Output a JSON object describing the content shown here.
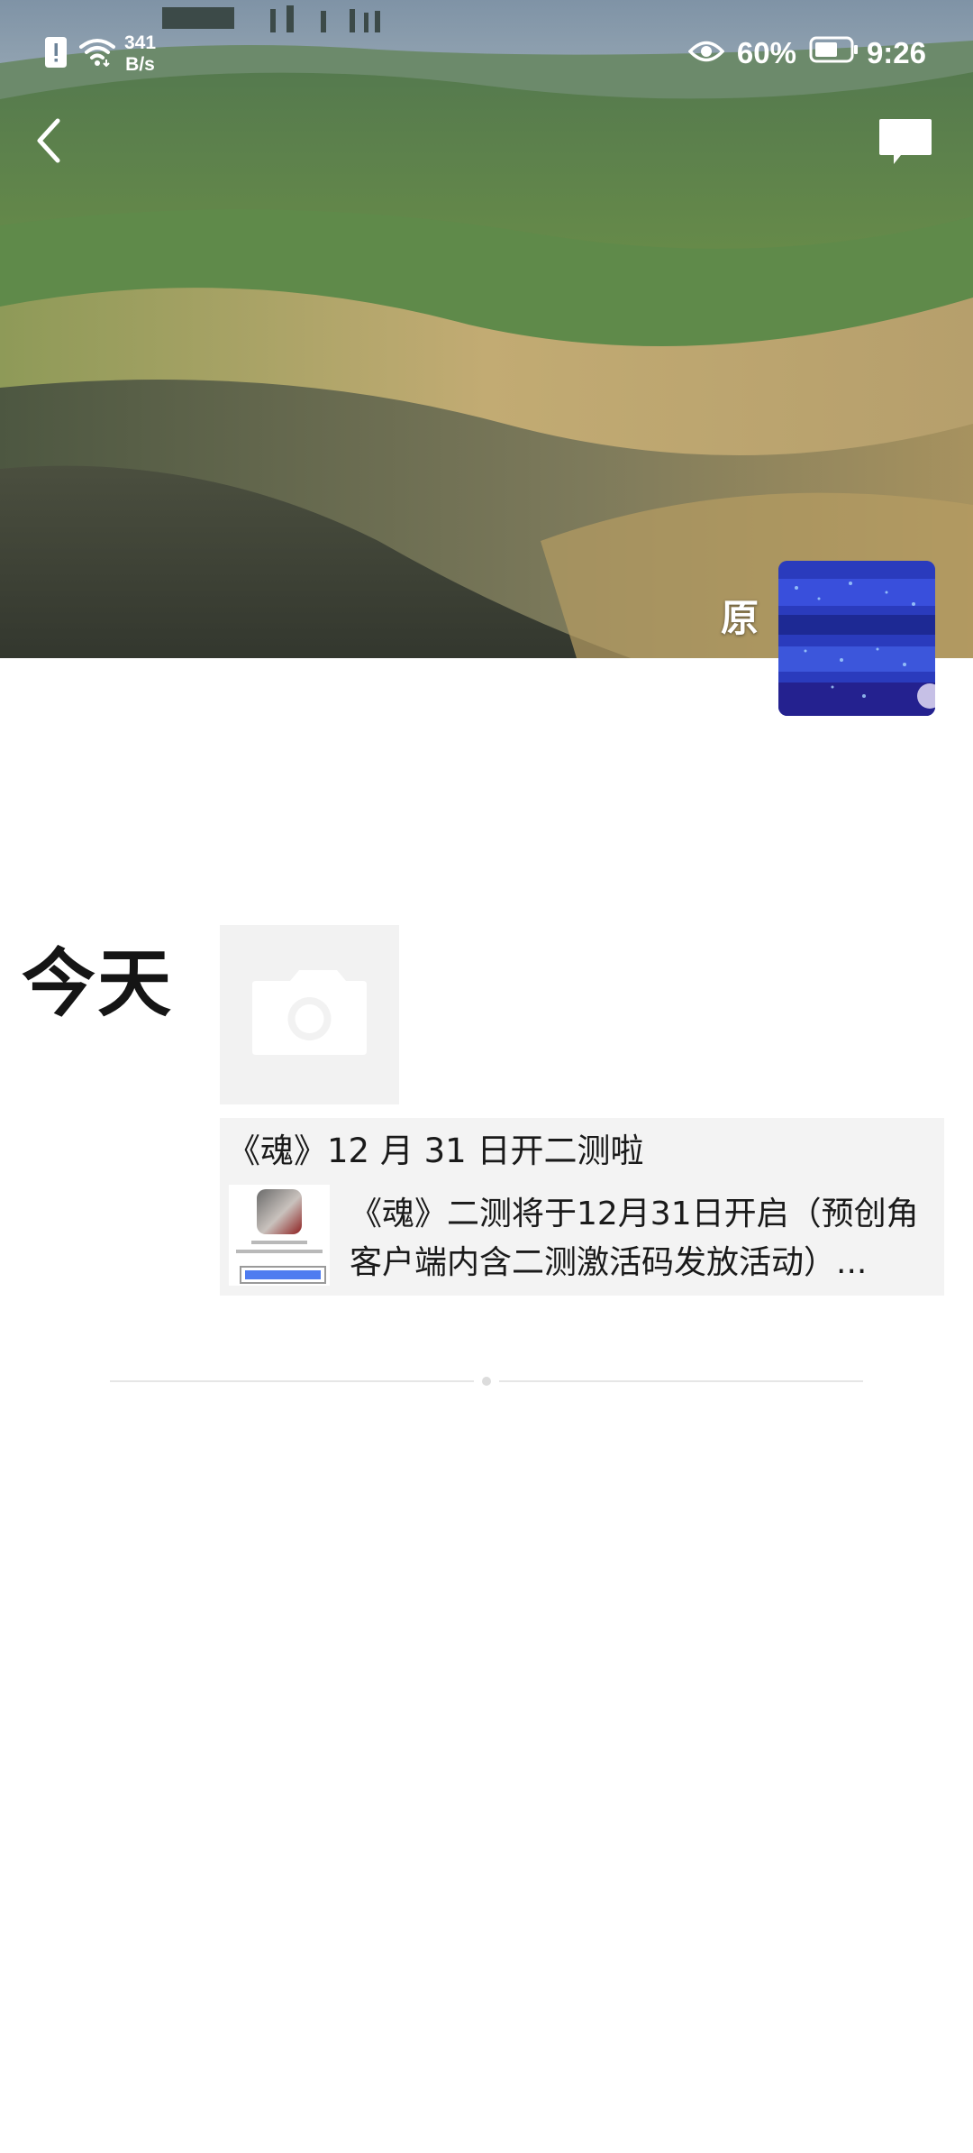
{
  "status_bar": {
    "net_speed_value": "341",
    "net_speed_unit": "B/s",
    "battery_percent": "60%",
    "time": "9:26",
    "icons": [
      "alert-icon",
      "wifi-icon",
      "eye-icon",
      "battery-icon"
    ]
  },
  "toolbar": {
    "back_icon": "back-arrow-icon",
    "comment_icon": "message-icon"
  },
  "profile": {
    "nickname": "原"
  },
  "post": {
    "date": "今天",
    "photo_icon": "camera-icon",
    "share": {
      "title": "《魂》12 月 31 日开二测啦",
      "description": "《魂》二测将于12月31日开启（预创角客户端内含二测激活码发放活动）..."
    }
  },
  "colors": {
    "background": "#ffffff",
    "card_bg": "#f3f3f3",
    "text": "#1a1a1a",
    "divider": "#e6e6e6"
  }
}
